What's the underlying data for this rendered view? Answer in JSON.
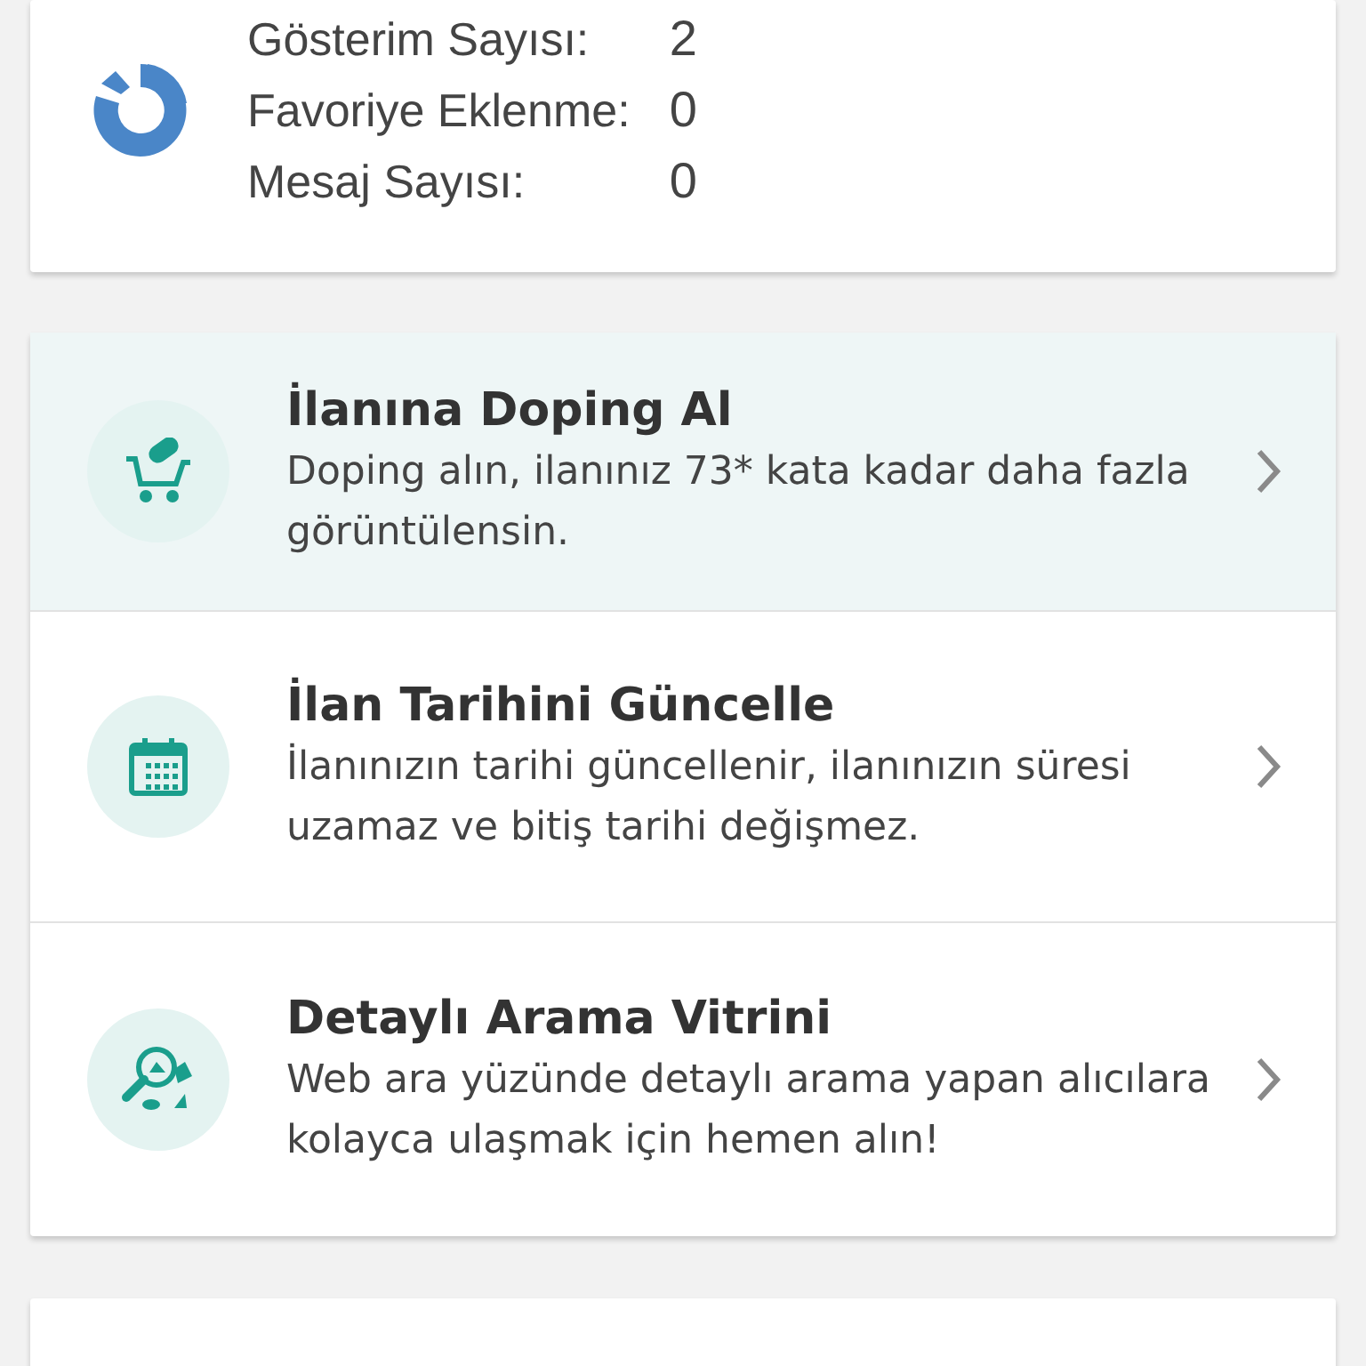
{
  "stats": [
    {
      "label": "Gösterim Sayısı:",
      "value": "2"
    },
    {
      "label": "Favoriye Eklenme:",
      "value": "0"
    },
    {
      "label": "Mesaj Sayısı:",
      "value": "0"
    }
  ],
  "actions": [
    {
      "kind": "doping",
      "title": "İlanına Doping Al",
      "description": "Doping alın, ilanınız 73* kata kadar daha fazla görüntülensin.",
      "selected": true
    },
    {
      "kind": "calendar",
      "title": "İlan Tarihini Güncelle",
      "description": "İlanınızın tarihi güncellenir, ilanınızın süresi uzamaz ve bitiş tarihi değişmez.",
      "selected": false
    },
    {
      "kind": "search",
      "title": "Detaylı Arama Vitrini",
      "description": "Web ara yüzünde detaylı arama yapan alıcılara kolayca ulaşmak için hemen alın!",
      "selected": false
    }
  ]
}
